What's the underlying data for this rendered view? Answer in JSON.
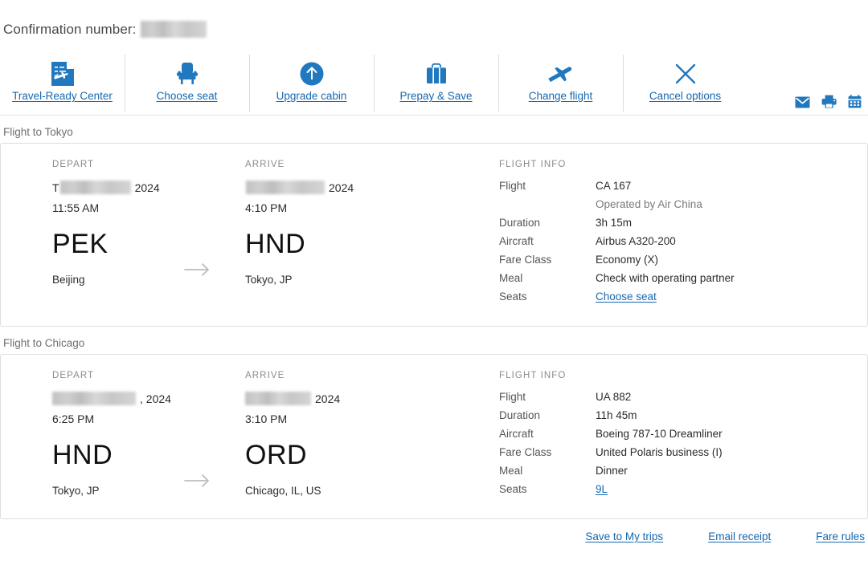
{
  "colors": {
    "brand_blue": "#2178be",
    "link_blue": "#1668b0",
    "muted_gray": "#8b8b8b",
    "border_gray": "#dedede"
  },
  "header": {
    "confirmation_label": "Confirmation number:",
    "confirmation_value_redacted": true
  },
  "toolbar": {
    "items": [
      {
        "label": "Travel-Ready Center",
        "icon": "travel-ready-document-icon"
      },
      {
        "label": "Choose seat",
        "icon": "seat-icon"
      },
      {
        "label": "Upgrade cabin",
        "icon": "upgrade-arrow-circle-icon"
      },
      {
        "label": "Prepay & Save",
        "icon": "suitcase-icon"
      },
      {
        "label": "Change flight",
        "icon": "airplane-icon"
      },
      {
        "label": "Cancel options",
        "icon": "close-x-icon"
      }
    ],
    "mini_actions": [
      {
        "name": "email-icon",
        "title": "Email"
      },
      {
        "name": "print-icon",
        "title": "Print"
      },
      {
        "name": "calendar-icon",
        "title": "Add to calendar"
      }
    ]
  },
  "flights": [
    {
      "section_title": "Flight to Tokyo",
      "depart": {
        "heading": "DEPART",
        "date_redacted": true,
        "date_prefix": "T",
        "date_suffix": "2024",
        "time": "11:55 AM",
        "code": "PEK",
        "city": "Beijing"
      },
      "arrive": {
        "heading": "ARRIVE",
        "date_redacted": true,
        "date_prefix": "",
        "date_suffix": "2024",
        "time": "4:10 PM",
        "code": "HND",
        "city": "Tokyo, JP"
      },
      "info": {
        "heading": "FLIGHT INFO",
        "flight_label": "Flight",
        "flight_value": "CA 167",
        "operated_by": "Operated by Air China",
        "duration_label": "Duration",
        "duration_value": "3h 15m",
        "aircraft_label": "Aircraft",
        "aircraft_value": "Airbus A320-200",
        "fare_class_label": "Fare Class",
        "fare_class_value": "Economy (X)",
        "meal_label": "Meal",
        "meal_value": "Check with operating partner",
        "seats_label": "Seats",
        "seats_value": "Choose seat",
        "seats_is_link": true
      }
    },
    {
      "section_title": "Flight to Chicago",
      "depart": {
        "heading": "DEPART",
        "date_redacted": true,
        "date_prefix": "",
        "date_suffix": ", 2024",
        "time": "6:25 PM",
        "code": "HND",
        "city": "Tokyo, JP"
      },
      "arrive": {
        "heading": "ARRIVE",
        "date_redacted": true,
        "date_prefix": "",
        "date_suffix": "2024",
        "time": "3:10 PM",
        "code": "ORD",
        "city": "Chicago, IL, US"
      },
      "info": {
        "heading": "FLIGHT INFO",
        "flight_label": "Flight",
        "flight_value": "UA 882",
        "operated_by": "",
        "duration_label": "Duration",
        "duration_value": "11h 45m",
        "aircraft_label": "Aircraft",
        "aircraft_value": "Boeing 787-10 Dreamliner",
        "fare_class_label": "Fare Class",
        "fare_class_value": "United Polaris business (I)",
        "meal_label": "Meal",
        "meal_value": "Dinner",
        "seats_label": "Seats",
        "seats_value": "9L",
        "seats_is_link": true
      }
    }
  ],
  "footer": {
    "links": [
      {
        "label": "Save to My trips"
      },
      {
        "label": "Email receipt"
      },
      {
        "label": "Fare rules"
      }
    ]
  }
}
